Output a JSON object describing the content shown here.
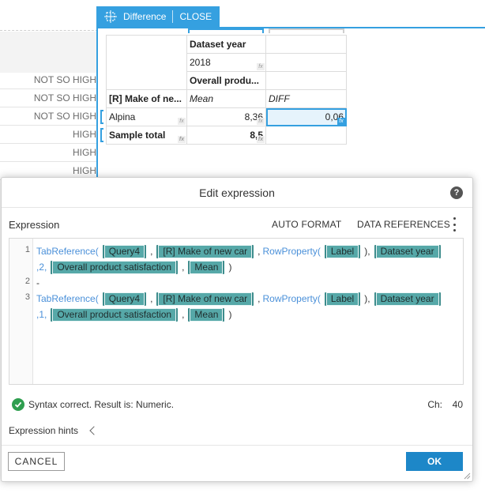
{
  "background": {
    "row_labels": [
      "NOT SO HIGH",
      "NOT SO HIGH",
      "NOT SO HIGH",
      "HIGH",
      "HIGH",
      "HIGH"
    ]
  },
  "panel": {
    "tab_title": "Difference",
    "close_label": "CLOSE",
    "accent": "#35a0e0"
  },
  "table": {
    "header_dataset": "Dataset year",
    "header_year": "2018",
    "header_measure": "Overall produ...",
    "row_header": "[R] Make of ne...",
    "col_mean": "Mean",
    "col_diff": "DIFF",
    "rows": [
      {
        "label": "Alpina",
        "mean": "8,36",
        "diff": "0,06"
      },
      {
        "label": "Sample total",
        "mean": "8,5",
        "diff": ""
      }
    ],
    "fx_glyph": "fx"
  },
  "dialog": {
    "title": "Edit expression",
    "help_glyph": "?",
    "expression_label": "Expression",
    "auto_format": "AUTO FORMAT",
    "data_references": "DATA REFERENCES",
    "code": {
      "line_numbers": [
        "1",
        "2",
        "3"
      ],
      "fn_tab": "TabReference(",
      "fn_row": "RowProperty(",
      "pill_query": "Query4",
      "pill_make": "[R] Make of new car",
      "pill_label": "Label",
      "pill_dataset": "Dataset year",
      "pill_overall": "Overall product satisfaction",
      "pill_mean": "Mean",
      "num_line1": ",2,",
      "num_line3": ",1,",
      "minus": "-",
      "comma": ",",
      "close_paren": ")",
      "close_paren_comma": "),"
    },
    "status_text": "Syntax correct. Result is: Numeric.",
    "ch_label": "Ch:",
    "ch_value": "40",
    "hints_label": "Expression hints",
    "cancel_label": "CANCEL",
    "ok_label": "OK",
    "ok_color": "#1d87c8",
    "success_color": "#2e9e4f"
  }
}
